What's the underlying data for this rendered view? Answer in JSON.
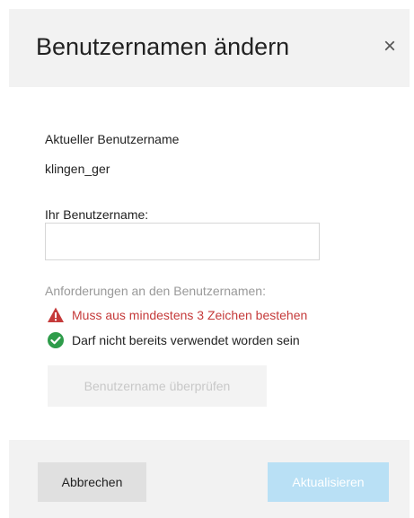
{
  "dialog": {
    "title": "Benutzernamen ändern",
    "close_symbol": "×"
  },
  "current": {
    "label": "Aktueller Benutzername",
    "value": "klingen_ger"
  },
  "username_field": {
    "label": "Ihr Benutzername:",
    "value": "",
    "placeholder": ""
  },
  "requirements": {
    "heading": "Anforderungen an den Benutzernamen:",
    "items": [
      {
        "text": "Muss aus mindestens 3 Zeichen bestehen",
        "status": "error",
        "icon": "warning-triangle-icon",
        "color": "#c53a3a"
      },
      {
        "text": "Darf nicht bereits verwendet worden sein",
        "status": "ok",
        "icon": "check-circle-icon",
        "color": "#2e9c4a"
      }
    ]
  },
  "buttons": {
    "check": "Benutzername überprüfen",
    "cancel": "Abbrechen",
    "update": "Aktualisieren"
  },
  "colors": {
    "header_bg": "#f2f2f2",
    "error": "#c53a3a",
    "success": "#2e9c4a",
    "update_disabled": "#b9e0f5"
  }
}
